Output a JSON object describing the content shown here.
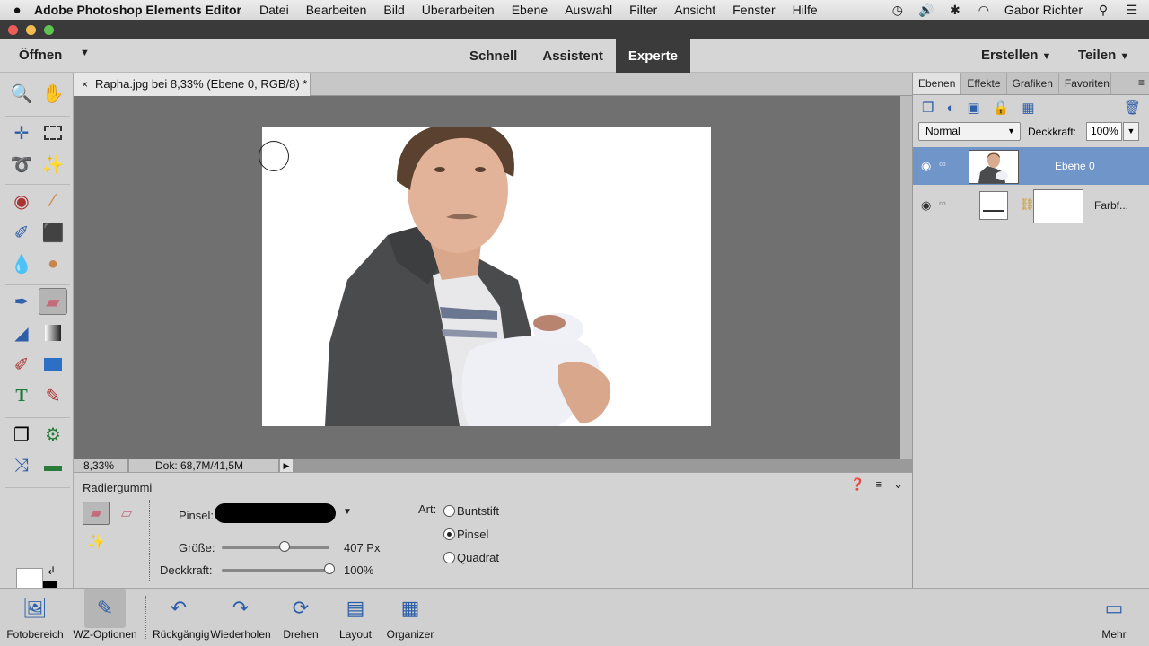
{
  "menubar": {
    "apple": "",
    "app": "Adobe Photoshop Elements Editor",
    "items": [
      "Datei",
      "Bearbeiten",
      "Bild",
      "Überarbeiten",
      "Ebene",
      "Auswahl",
      "Filter",
      "Ansicht",
      "Fenster",
      "Hilfe"
    ],
    "user": "Gabor Richter"
  },
  "toolbar": {
    "open": "Öffnen",
    "modes": [
      "Schnell",
      "Assistent",
      "Experte"
    ],
    "active_mode": "Experte",
    "create": "Erstellen",
    "share": "Teilen"
  },
  "document": {
    "tab_title": "Rapha.jpg bei 8,33% (Ebene 0, RGB/8) *",
    "close": "×",
    "zoom": "8,33%",
    "doc_size": "Dok: 68,7M/41,5M"
  },
  "tool_options": {
    "title": "Radiergummi",
    "brush_label": "Pinsel:",
    "size_label": "Größe:",
    "size_value": "407 Px",
    "size_level": 0.58,
    "opacity_label": "Deckkraft:",
    "opacity_value": "100%",
    "opacity_level": 1.0,
    "type_label": "Art:",
    "types": [
      "Buntstift",
      "Pinsel",
      "Quadrat"
    ],
    "selected_type": "Pinsel"
  },
  "layers_panel": {
    "tabs": [
      "Ebenen",
      "Effekte",
      "Grafiken",
      "Favoriten"
    ],
    "active_tab": "Ebenen",
    "blend_mode": "Normal",
    "opacity_label": "Deckkraft:",
    "opacity_value": "100%",
    "layers": [
      {
        "name": "Ebene 0",
        "selected": true
      },
      {
        "name": "Farbf...",
        "selected": false
      }
    ]
  },
  "taskbar": {
    "items": [
      "Fotobereich",
      "WZ-Optionen",
      "Rückgängig",
      "Wiederholen",
      "Drehen",
      "Layout",
      "Organizer"
    ],
    "more": "Mehr"
  },
  "colors": {
    "accent": "#6f95c9",
    "active_mode_bg": "#3b3b3b",
    "foreground": "#ffffff",
    "background": "#000000"
  }
}
